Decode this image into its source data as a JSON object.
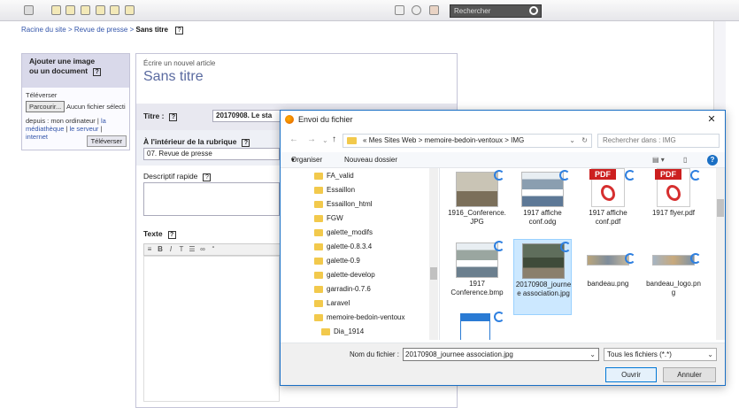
{
  "toolbar": {
    "search_placeholder": "Rechercher"
  },
  "breadcrumb": {
    "root": "Racine du site",
    "sep": ">",
    "section": "Revue de presse",
    "current": "Sans titre",
    "help": "?"
  },
  "upload": {
    "title_line1": "Ajouter une image",
    "title_line2": "ou un document",
    "help": "?",
    "televerser_label": "Téléverser",
    "browse_label": "Parcourir...",
    "no_file": "Aucun fichier sélectionné",
    "from_label": "depuis : mon ordinateur",
    "link_mediatheque": "la médiathèque",
    "link_serveur": "le serveur",
    "link_internet": "internet",
    "submit": "Téléverser"
  },
  "editor": {
    "new_article": "Écrire un nouvel article",
    "page_title": "Sans titre",
    "titre_label": "Titre :",
    "titre_value": "20170908. Le sta",
    "rubrique_label": "À l'intérieur de la rubrique",
    "rubrique_value": "07. Revue de presse",
    "descriptif_label": "Descriptif rapide",
    "texte_label": "Texte",
    "help": "?"
  },
  "dialog": {
    "title": "Envoi du fichier",
    "close": "✕",
    "path": [
      "«",
      "Mes Sites Web",
      ">",
      "memoire-bedoin-ventoux",
      ">",
      "IMG"
    ],
    "search_placeholder": "Rechercher dans : IMG",
    "organiser": "Organiser",
    "nouveau_dossier": "Nouveau dossier",
    "help": "?",
    "tree": [
      "FA_valid",
      "Essaillon",
      "Essaillon_html",
      "FGW",
      "galette_modifs",
      "galette-0.8.3.4",
      "galette-0.9",
      "galette-develop",
      "garradin-0.7.6",
      "Laravel",
      "memoire-bedoin-ventoux",
      "Dia_1914"
    ],
    "files": [
      {
        "name": "1916_Conference.JPG",
        "kind": "photo"
      },
      {
        "name": "1917 affiche conf.odg",
        "kind": "photo"
      },
      {
        "name": "1917 affiche conf.pdf",
        "kind": "pdf"
      },
      {
        "name": "1917 flyer.pdf",
        "kind": "pdf"
      },
      {
        "name": "1917 Conference.bmp",
        "kind": "photo"
      },
      {
        "name": "20170908_journee association.jpg",
        "kind": "photo"
      },
      {
        "name": "bandeau.png",
        "kind": "banner"
      },
      {
        "name": "bandeau_logo.png",
        "kind": "banner"
      },
      {
        "name": "",
        "kind": "doc"
      }
    ],
    "pdf_band": "PDF",
    "filename_label": "Nom du fichier :",
    "filename_value": "20170908_journee association.jpg",
    "filetype_value": "Tous les fichiers (*.*)",
    "open_button": "Ouvrir",
    "cancel_button": "Annuler"
  }
}
